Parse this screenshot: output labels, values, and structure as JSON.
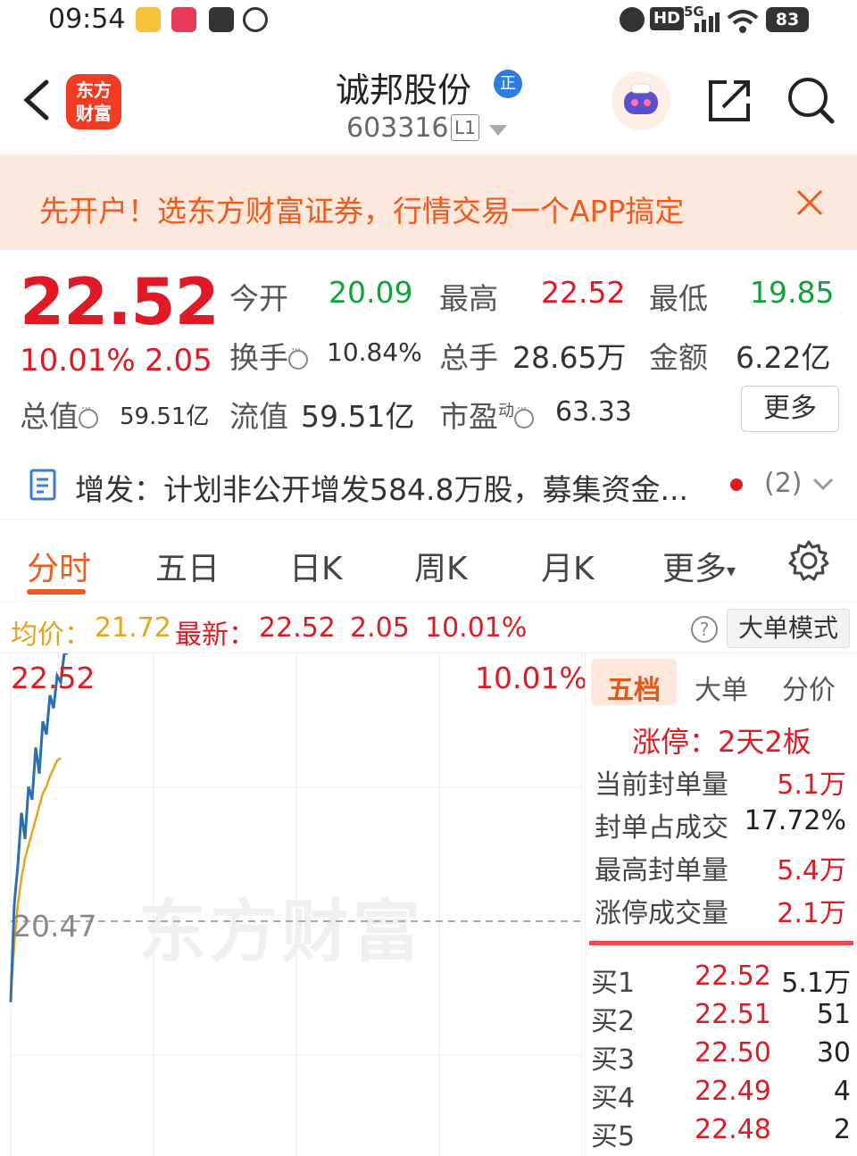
{
  "status_bar": {
    "time": "09:54",
    "hd": "HD",
    "network": "5G",
    "battery": "83",
    "icons": [
      "weibo-icon",
      "app-icon",
      "mail-icon",
      "app-icon-2",
      "alarm-icon",
      "signal-icon",
      "wifi-icon"
    ]
  },
  "header": {
    "logo_text": "东方财富",
    "stock_name": "诚邦股份",
    "badge": "正",
    "stock_code": "603316",
    "level": "L1"
  },
  "banner": {
    "text": "先开户！选东方财富证券，行情交易一个APP搞定"
  },
  "quote": {
    "price": "22.52",
    "change_pct": "10.01%",
    "change_amt": "2.05",
    "rows": [
      {
        "label": "今开",
        "value": "20.09"
      },
      {
        "label": "最高",
        "value": "22.52"
      },
      {
        "label": "最低",
        "value": "19.85"
      },
      {
        "label": "换手",
        "value": "10.84%"
      },
      {
        "label": "总手",
        "value": "28.65万"
      },
      {
        "label": "金额",
        "value": "6.22亿"
      },
      {
        "label": "总值",
        "value": "59.51亿"
      },
      {
        "label": "流值",
        "value": "59.51亿"
      },
      {
        "label": "市盈",
        "superscript": "动",
        "value": "63.33"
      }
    ],
    "more_label": "更多"
  },
  "notice": {
    "text": "增发：计划非公开增发584.8万股，募集资金...",
    "count": "(2)"
  },
  "tabs": {
    "items": [
      "分时",
      "五日",
      "日K",
      "周K",
      "月K",
      "更多"
    ],
    "active": "分时"
  },
  "info_row": {
    "avg_label": "均价：",
    "avg_value": "21.72",
    "latest_label": "最新：",
    "latest_value": "22.52",
    "latest_chg": "2.05",
    "latest_pct": "10.01%",
    "help": "?",
    "big_order_label": "大单模式"
  },
  "chart": {
    "max_label": "22.52",
    "mid_label": "20.47",
    "pct_label": "10.01%",
    "watermark": "东方财富",
    "colors": {
      "price": "#2a6fb0",
      "avg": "#e8a317",
      "mid": "#aaaaaa"
    }
  },
  "chart_data": {
    "type": "line",
    "ylim": [
      18.42,
      22.52
    ],
    "reference": 20.47,
    "series": [
      {
        "values": [
          19.85,
          20.6,
          20.9,
          21.3,
          21.1,
          21.5,
          21.4,
          21.8,
          21.6,
          22.0,
          21.9,
          22.2,
          22.1,
          22.35,
          22.3,
          22.52,
          22.52
        ]
      },
      {
        "values": [
          19.9,
          20.3,
          20.6,
          20.8,
          20.95,
          21.05,
          21.15,
          21.25,
          21.35,
          21.45,
          21.5,
          21.58,
          21.64,
          21.7,
          21.72
        ]
      }
    ]
  },
  "order_book": {
    "tabs": [
      "五档",
      "大单",
      "分价"
    ],
    "limit_title": "涨停：2天2板",
    "limit_rows": [
      {
        "label": "当前封单量",
        "value": "5.1万"
      },
      {
        "label": "封单占成交",
        "value": "17.72%"
      },
      {
        "label": "最高封单量",
        "value": "5.4万"
      },
      {
        "label": "涨停成交量",
        "value": "2.1万"
      }
    ],
    "bids": [
      {
        "label": "买1",
        "price": "22.52",
        "qty": "5.1万"
      },
      {
        "label": "买2",
        "price": "22.51",
        "qty": "51"
      },
      {
        "label": "买3",
        "price": "22.50",
        "qty": "30"
      },
      {
        "label": "买4",
        "price": "22.49",
        "qty": "4"
      },
      {
        "label": "买5",
        "price": "22.48",
        "qty": "2"
      }
    ]
  }
}
